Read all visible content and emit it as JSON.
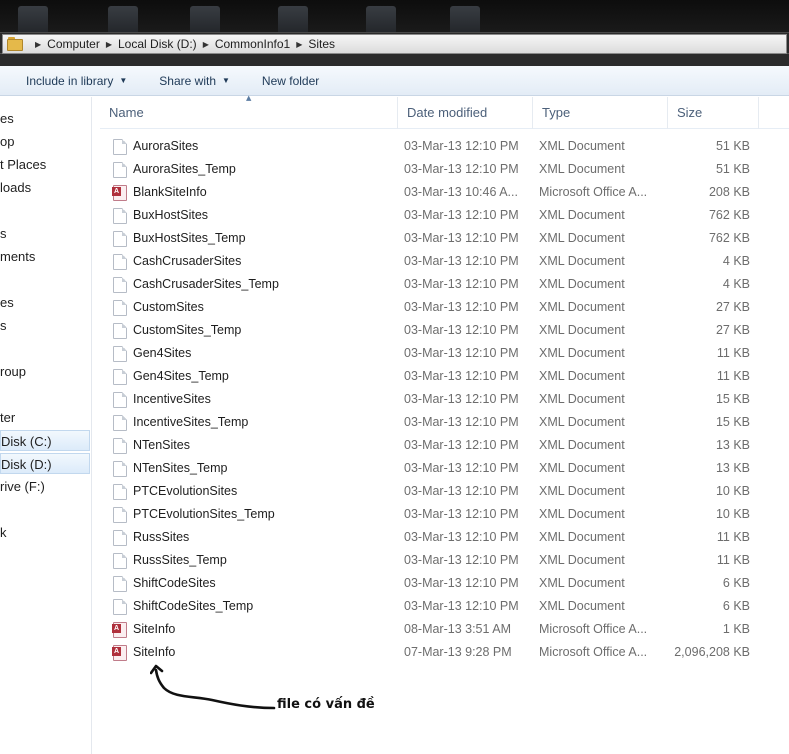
{
  "breadcrumb": {
    "items": [
      "Computer",
      "Local Disk (D:)",
      "CommonInfo1",
      "Sites"
    ]
  },
  "toolbar": {
    "include_label": "Include in library",
    "share_label": "Share with",
    "new_folder_label": "New folder"
  },
  "nav": {
    "items": [
      "es",
      "op",
      "t Places",
      "loads",
      "s",
      "ments",
      "es",
      "s",
      "roup",
      "ter",
      "Disk (C:)",
      "Disk (D:)",
      "rive (F:)",
      "k"
    ]
  },
  "columns": {
    "name": "Name",
    "date": "Date modified",
    "type": "Type",
    "size": "Size"
  },
  "files": [
    {
      "name": "AuroraSites",
      "date": "03-Mar-13 12:10 PM",
      "type": "XML Document",
      "size": "51 KB",
      "icon": "xml-document-icon"
    },
    {
      "name": "AuroraSites_Temp",
      "date": "03-Mar-13 12:10 PM",
      "type": "XML Document",
      "size": "51 KB",
      "icon": "xml-document-icon"
    },
    {
      "name": "BlankSiteInfo",
      "date": "03-Mar-13 10:46 A...",
      "type": "Microsoft Office A...",
      "size": "208 KB",
      "icon": "access-database-icon"
    },
    {
      "name": "BuxHostSites",
      "date": "03-Mar-13 12:10 PM",
      "type": "XML Document",
      "size": "762 KB",
      "icon": "xml-document-icon"
    },
    {
      "name": "BuxHostSites_Temp",
      "date": "03-Mar-13 12:10 PM",
      "type": "XML Document",
      "size": "762 KB",
      "icon": "xml-document-icon"
    },
    {
      "name": "CashCrusaderSites",
      "date": "03-Mar-13 12:10 PM",
      "type": "XML Document",
      "size": "4 KB",
      "icon": "xml-document-icon"
    },
    {
      "name": "CashCrusaderSites_Temp",
      "date": "03-Mar-13 12:10 PM",
      "type": "XML Document",
      "size": "4 KB",
      "icon": "xml-document-icon"
    },
    {
      "name": "CustomSites",
      "date": "03-Mar-13 12:10 PM",
      "type": "XML Document",
      "size": "27 KB",
      "icon": "xml-document-icon"
    },
    {
      "name": "CustomSites_Temp",
      "date": "03-Mar-13 12:10 PM",
      "type": "XML Document",
      "size": "27 KB",
      "icon": "xml-document-icon"
    },
    {
      "name": "Gen4Sites",
      "date": "03-Mar-13 12:10 PM",
      "type": "XML Document",
      "size": "11 KB",
      "icon": "xml-document-icon"
    },
    {
      "name": "Gen4Sites_Temp",
      "date": "03-Mar-13 12:10 PM",
      "type": "XML Document",
      "size": "11 KB",
      "icon": "xml-document-icon"
    },
    {
      "name": "IncentiveSites",
      "date": "03-Mar-13 12:10 PM",
      "type": "XML Document",
      "size": "15 KB",
      "icon": "xml-document-icon"
    },
    {
      "name": "IncentiveSites_Temp",
      "date": "03-Mar-13 12:10 PM",
      "type": "XML Document",
      "size": "15 KB",
      "icon": "xml-document-icon"
    },
    {
      "name": "NTenSites",
      "date": "03-Mar-13 12:10 PM",
      "type": "XML Document",
      "size": "13 KB",
      "icon": "xml-document-icon"
    },
    {
      "name": "NTenSites_Temp",
      "date": "03-Mar-13 12:10 PM",
      "type": "XML Document",
      "size": "13 KB",
      "icon": "xml-document-icon"
    },
    {
      "name": "PTCEvolutionSites",
      "date": "03-Mar-13 12:10 PM",
      "type": "XML Document",
      "size": "10 KB",
      "icon": "xml-document-icon"
    },
    {
      "name": "PTCEvolutionSites_Temp",
      "date": "03-Mar-13 12:10 PM",
      "type": "XML Document",
      "size": "10 KB",
      "icon": "xml-document-icon"
    },
    {
      "name": "RussSites",
      "date": "03-Mar-13 12:10 PM",
      "type": "XML Document",
      "size": "11 KB",
      "icon": "xml-document-icon"
    },
    {
      "name": "RussSites_Temp",
      "date": "03-Mar-13 12:10 PM",
      "type": "XML Document",
      "size": "11 KB",
      "icon": "xml-document-icon"
    },
    {
      "name": "ShiftCodeSites",
      "date": "03-Mar-13 12:10 PM",
      "type": "XML Document",
      "size": "6 KB",
      "icon": "xml-document-icon"
    },
    {
      "name": "ShiftCodeSites_Temp",
      "date": "03-Mar-13 12:10 PM",
      "type": "XML Document",
      "size": "6 KB",
      "icon": "xml-document-icon"
    },
    {
      "name": "SiteInfo",
      "date": "08-Mar-13 3:51 AM",
      "type": "Microsoft Office A...",
      "size": "1 KB",
      "icon": "access-lock-icon"
    },
    {
      "name": "SiteInfo",
      "date": "07-Mar-13 9:28 PM",
      "type": "Microsoft Office A...",
      "size": "2,096,208 KB",
      "icon": "access-database-icon"
    }
  ],
  "annotation": {
    "text": "file có vấn đề"
  }
}
